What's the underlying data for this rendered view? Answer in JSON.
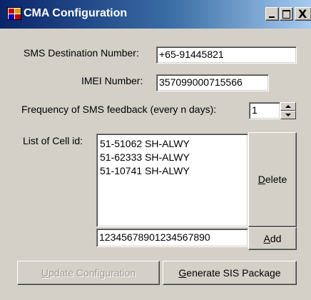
{
  "window": {
    "title": "CMA Configuration",
    "title_bar_color": "#0a246a",
    "face_color": "#d4d0c8",
    "controls": [
      "minimize-icon",
      "maximize-icon",
      "close-icon"
    ],
    "close_glyph": "X"
  },
  "form": {
    "sms_label": "SMS Destination Number:",
    "sms_value": "+65-91445821",
    "imei_label": "IMEI Number:",
    "imei_value": "357099000715566",
    "freq_label": "Frequency of SMS feedback (every n days):",
    "freq_value": "1",
    "cell_label": "List of Cell id:",
    "cell_items": [
      "51-51062 SH-ALWY",
      "51-62333 SH-ALWY",
      "51-10741 SH-ALWY"
    ],
    "cell_input_value": "12345678901234567890"
  },
  "buttons": {
    "delete_hotkey": "D",
    "delete_rest": "elete",
    "add_hotkey": "A",
    "add_rest": "dd",
    "update_hotkey": "U",
    "update_rest": "pdate Configuration",
    "update_enabled": false,
    "generate_hotkey": "G",
    "generate_rest": "enerate SIS Package"
  }
}
